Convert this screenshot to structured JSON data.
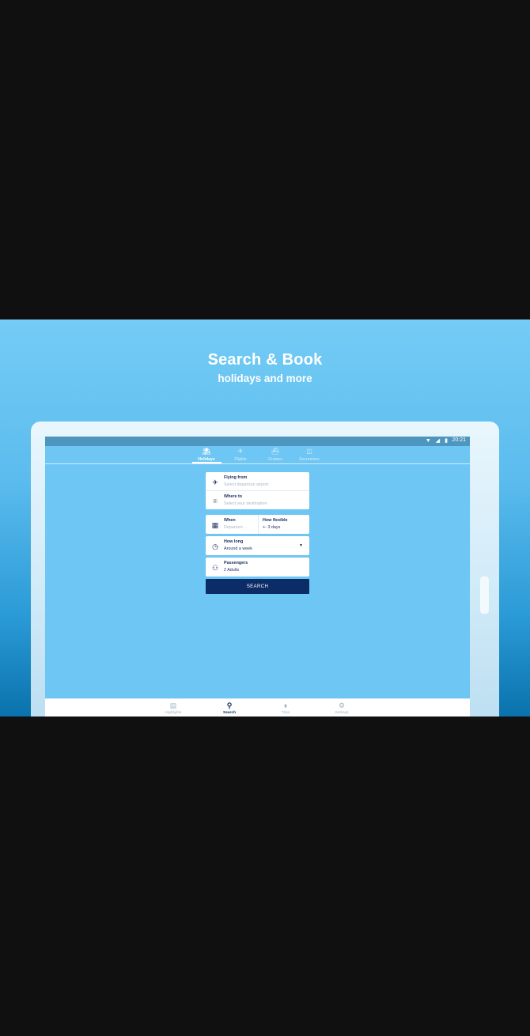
{
  "promo": {
    "headline": "Search & Book",
    "subheadline": "holidays and more"
  },
  "status_bar": {
    "time": "20:21",
    "icons": [
      "wifi-icon",
      "signal-icon",
      "battery-icon"
    ]
  },
  "top_tabs": [
    {
      "label": "Holidays",
      "icon": "holiday-icon",
      "active": true
    },
    {
      "label": "Flights",
      "icon": "plane-icon",
      "active": false
    },
    {
      "label": "Cruises",
      "icon": "cruise-icon",
      "active": false
    },
    {
      "label": "Excursions",
      "icon": "excursion-icon",
      "active": false
    }
  ],
  "form": {
    "flying_from": {
      "label": "Flying from",
      "placeholder": "Select departure airport"
    },
    "where_to": {
      "label": "Where to",
      "placeholder": "Select your destination"
    },
    "when": {
      "label": "When",
      "placeholder": "Departure ..."
    },
    "how_flexible": {
      "label": "How flexible",
      "value": "+- 3 days"
    },
    "how_long": {
      "label": "How long",
      "value": "Around a week"
    },
    "passengers": {
      "label": "Passengers",
      "value": "2 Adults"
    },
    "search_button": "SEARCH"
  },
  "bottom_tabs": [
    {
      "label": "Highlights",
      "icon": "highlights-icon",
      "active": false
    },
    {
      "label": "Search",
      "icon": "search-icon",
      "active": true
    },
    {
      "label": "Trips",
      "icon": "tag-icon",
      "active": false
    },
    {
      "label": "Settings",
      "icon": "gear-icon",
      "active": false
    }
  ],
  "colors": {
    "screen_bg": "#6ec6f4",
    "status_bar": "#4f96bf",
    "primary_navy": "#0b2c66"
  }
}
